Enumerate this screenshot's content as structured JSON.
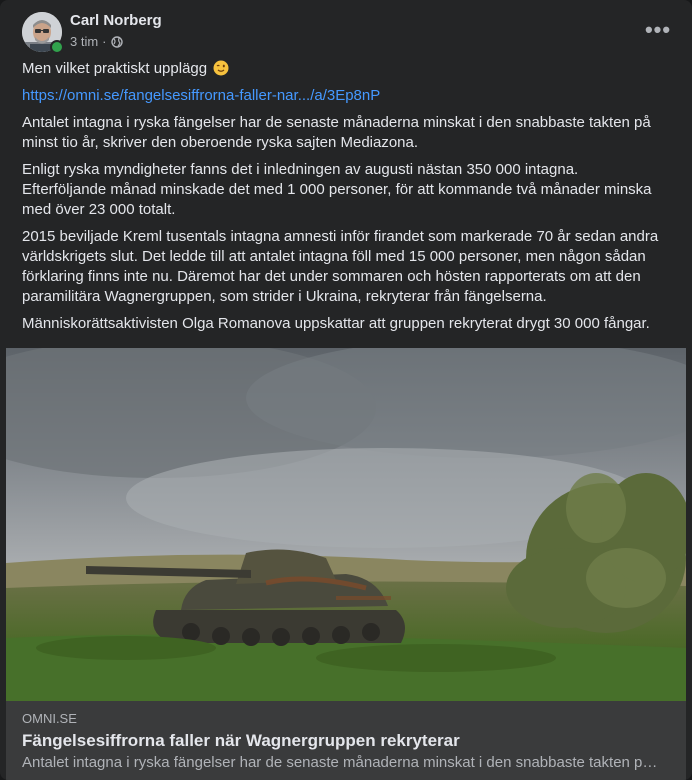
{
  "post": {
    "author": "Carl Norberg",
    "time": "3 tim",
    "separator": "·",
    "audience_icon": "globe-icon",
    "more_icon": "more-dots-icon",
    "more_label": "•••",
    "text_intro": "Men vilket praktiskt upplägg",
    "emoji": "winking-face-emoji",
    "link_url": "https://omni.se/fangelsesiffrorna-faller-nar.../a/3Ep8nP",
    "paragraphs": [
      "Antalet intagna i ryska fängelser har de senaste månaderna minskat i den snabbaste takten på minst tio år, skriver den oberoende ryska sajten Mediazona.",
      "Enligt ryska myndigheter fanns det i inledningen av augusti nästan 350 000 intagna. Efterföljande månad minskade det med 1 000 personer, för att kommande två månader minska med över 23 000 totalt.",
      "2015 beviljade Kreml tusentals intagna amnesti inför firandet som markerade 70 år sedan andra världskrigets slut. Det ledde till att antalet intagna föll med 15 000 personer, men någon sådan förklaring finns inte nu. Däremot har det under sommaren och hösten rapporterats om att den paramilitära Wagnergruppen, som strider i Ukraina, rekryterar från fängelserna.",
      "Människorättsaktivisten Olga Romanova uppskattar att gruppen rekryterat drygt 30 000 fångar."
    ]
  },
  "link_preview": {
    "image": "destroyed-tank-in-field-photo",
    "domain": "OMNI.SE",
    "title": "Fängelsesiffrorna faller när Wagnergruppen rekryterar",
    "description": "Antalet intagna i ryska fängelser har de senaste månaderna minskat i den snabbaste takten på minst tio år, skriver den oberoende ryska sajten Mediazona."
  },
  "colors": {
    "background": "#242526",
    "text": "#e4e6eb",
    "secondary_text": "#b0b3b8",
    "link": "#4599ff",
    "online": "#31a24c"
  }
}
